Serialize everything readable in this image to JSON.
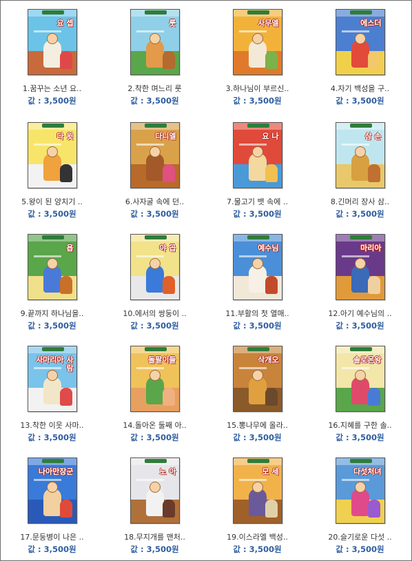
{
  "books": [
    {
      "cover_title": "요 셉",
      "caption": "1.꿈꾸는 소년 요..",
      "price": "값 : 3,500원",
      "colors": {
        "bg": "#6cc3e8",
        "ground": "#c86a3c",
        "figure": "#f3eee0",
        "figure2": "#e04848"
      }
    },
    {
      "cover_title": "룻",
      "caption": "2.착한 며느리 룻",
      "price": "값 : 3,500원",
      "colors": {
        "bg": "#8fd0e8",
        "ground": "#5aa64a",
        "figure": "#e39a4a",
        "figure2": "#b56a2f"
      }
    },
    {
      "cover_title": "사무엘",
      "caption": "3.하나님이 부르신..",
      "price": "값 : 3,500원",
      "colors": {
        "bg": "#f2b23a",
        "ground": "#e07a2a",
        "figure": "#f4e9d6",
        "figure2": "#7cb24a"
      }
    },
    {
      "cover_title": "에스더",
      "caption": "4.자기 백성을 구..",
      "price": "값 : 3,500원",
      "colors": {
        "bg": "#4c7fd0",
        "ground": "#f0d04a",
        "figure": "#e24a3a",
        "figure2": "#f2c86a"
      }
    },
    {
      "cover_title": "다 윗",
      "caption": "5.왕이 된 양치기 ..",
      "price": "값 : 3,500원",
      "colors": {
        "bg": "#f7e56a",
        "ground": "#f2f2f2",
        "figure": "#f0a23c",
        "figure2": "#333333"
      }
    },
    {
      "cover_title": "다니엘",
      "caption": "6.사자굴 속에 던..",
      "price": "값 : 3,500원",
      "colors": {
        "bg": "#d9a24a",
        "ground": "#b86a2a",
        "figure": "#a35a28",
        "figure2": "#e05080"
      }
    },
    {
      "cover_title": "요 나",
      "caption": "7.물고기 뱃 속에 ..",
      "price": "값 : 3,500원",
      "colors": {
        "bg": "#e04a3a",
        "ground": "#4a9ad8",
        "figure": "#f3d8a0",
        "figure2": "#f2c050"
      }
    },
    {
      "cover_title": "삼 손",
      "caption": "8.긴머리 장사 삼..",
      "price": "값 : 3,500원",
      "colors": {
        "bg": "#bfe6ef",
        "ground": "#e8c86a",
        "figure": "#d8a040",
        "figure2": "#c07030"
      }
    },
    {
      "cover_title": "욥",
      "caption": "9.끝까지 하나님을..",
      "price": "값 : 3,500원",
      "colors": {
        "bg": "#5aa64a",
        "ground": "#f0e08a",
        "figure": "#4a7ad8",
        "figure2": "#c8702a"
      }
    },
    {
      "cover_title": "야 곱",
      "caption": "10.에서의 쌍둥이 ..",
      "price": "값 : 3,500원",
      "colors": {
        "bg": "#f2e28a",
        "ground": "#e8e8e8",
        "figure": "#3a7ad8",
        "figure2": "#e0602a"
      }
    },
    {
      "cover_title": "예수님",
      "caption": "11.부활의 첫 열매..",
      "price": "값 : 3,500원",
      "colors": {
        "bg": "#4a8fd8",
        "ground": "#f2e8d8",
        "figure": "#f6f0e6",
        "figure2": "#c24a2a"
      }
    },
    {
      "cover_title": "마리아",
      "caption": "12.아기 예수님의 ..",
      "price": "값 : 3,500원",
      "colors": {
        "bg": "#6a3a8a",
        "ground": "#e09a3a",
        "figure": "#3a6ab8",
        "figure2": "#f0d0a0"
      }
    },
    {
      "cover_title": "사마리아 사람",
      "caption": "13.착한 이웃 사마..",
      "price": "값 : 3,500원",
      "colors": {
        "bg": "#7ac3ea",
        "ground": "#f2f2f2",
        "figure": "#f2e6c8",
        "figure2": "#e04a4a"
      }
    },
    {
      "cover_title": "돌팔이들",
      "caption": "14.돌아온 둘째 아..",
      "price": "값 : 3,500원",
      "colors": {
        "bg": "#f0c25a",
        "ground": "#e8a060",
        "figure": "#5aa64a",
        "figure2": "#f0b080"
      }
    },
    {
      "cover_title": "삭개오",
      "caption": "15.뽕나무에 올라..",
      "price": "값 : 3,500원",
      "colors": {
        "bg": "#c8843a",
        "ground": "#8a5a2a",
        "figure": "#e0a040",
        "figure2": "#6a4a2a"
      }
    },
    {
      "cover_title": "솔로몬왕",
      "caption": "16.지혜를 구한 솔..",
      "price": "값 : 3,500원",
      "colors": {
        "bg": "#f2e6a8",
        "ground": "#5aa64a",
        "figure": "#e04a6a",
        "figure2": "#4a7ad8"
      }
    },
    {
      "cover_title": "나아만장군",
      "caption": "17.문둥병이 나은 ..",
      "price": "값 : 3,500원",
      "colors": {
        "bg": "#3a7ad8",
        "ground": "#2a5ab8",
        "figure": "#f2d0a0",
        "figure2": "#e04a3a"
      }
    },
    {
      "cover_title": "노 아",
      "caption": "18.무지개를 맨처..",
      "price": "값 : 3,500원",
      "colors": {
        "bg": "#e6e6ea",
        "ground": "#b0703a",
        "figure": "#f2f2f2",
        "figure2": "#6a3a2a"
      }
    },
    {
      "cover_title": "모 세",
      "caption": "19.이스라엘 백성..",
      "price": "값 : 3,500원",
      "colors": {
        "bg": "#f2b24a",
        "ground": "#a0602a",
        "figure": "#6a5a9a",
        "figure2": "#e0d0a8"
      }
    },
    {
      "cover_title": "다섯처녀",
      "caption": "20.슬기로운 다섯 ..",
      "price": "값 : 3,500원",
      "colors": {
        "bg": "#5a9ad8",
        "ground": "#f0d050",
        "figure": "#e04a8a",
        "figure2": "#9a5ad0"
      }
    }
  ]
}
